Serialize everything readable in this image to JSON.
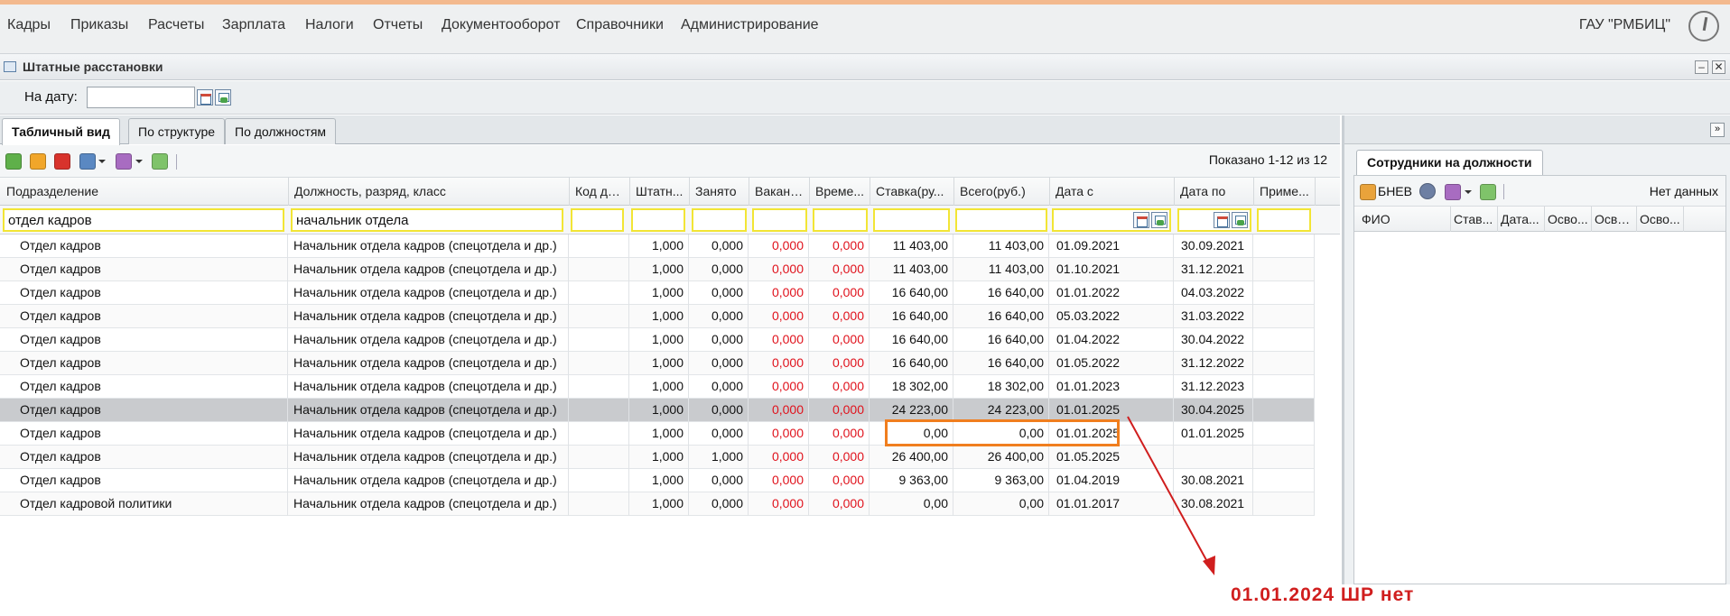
{
  "menu": {
    "items": [
      "Кадры",
      "Приказы",
      "Расчеты",
      "Зарплата",
      "Налоги",
      "Отчеты",
      "Документооборот",
      "Справочники",
      "Администрирование"
    ],
    "org": "ГАУ \"РМБИЦ\""
  },
  "window": {
    "title": "Штатные расстановки"
  },
  "date_filter": {
    "label": "На дату:",
    "value": ""
  },
  "tabs": [
    "Табличный вид",
    "По структуре",
    "По должностям"
  ],
  "toolbar": {
    "shown": "Показано 1-12 из 12"
  },
  "columns": [
    "Подразделение",
    "Должность, разряд, класс",
    "Код до...",
    "Штатн...",
    "Занято",
    "Вакант...",
    "Време...",
    "Ставка(ру...",
    "Всего(руб.)",
    "Дата с",
    "Дата по",
    "Приме..."
  ],
  "filters": {
    "department": "отдел кадров",
    "position": "начальник отдела"
  },
  "rows": [
    [
      "Отдел кадров",
      "Начальник отдела кадров (спецотдела и др.)",
      "",
      "1,000",
      "0,000",
      "0,000",
      "0,000",
      "11 403,00",
      "11 403,00",
      "01.09.2021",
      "30.09.2021",
      ""
    ],
    [
      "Отдел кадров",
      "Начальник отдела кадров (спецотдела и др.)",
      "",
      "1,000",
      "0,000",
      "0,000",
      "0,000",
      "11 403,00",
      "11 403,00",
      "01.10.2021",
      "31.12.2021",
      ""
    ],
    [
      "Отдел кадров",
      "Начальник отдела кадров (спецотдела и др.)",
      "",
      "1,000",
      "0,000",
      "0,000",
      "0,000",
      "16 640,00",
      "16 640,00",
      "01.01.2022",
      "04.03.2022",
      ""
    ],
    [
      "Отдел кадров",
      "Начальник отдела кадров (спецотдела и др.)",
      "",
      "1,000",
      "0,000",
      "0,000",
      "0,000",
      "16 640,00",
      "16 640,00",
      "05.03.2022",
      "31.03.2022",
      ""
    ],
    [
      "Отдел кадров",
      "Начальник отдела кадров (спецотдела и др.)",
      "",
      "1,000",
      "0,000",
      "0,000",
      "0,000",
      "16 640,00",
      "16 640,00",
      "01.04.2022",
      "30.04.2022",
      ""
    ],
    [
      "Отдел кадров",
      "Начальник отдела кадров (спецотдела и др.)",
      "",
      "1,000",
      "0,000",
      "0,000",
      "0,000",
      "16 640,00",
      "16 640,00",
      "01.05.2022",
      "31.12.2022",
      ""
    ],
    [
      "Отдел кадров",
      "Начальник отдела кадров (спецотдела и др.)",
      "",
      "1,000",
      "0,000",
      "0,000",
      "0,000",
      "18 302,00",
      "18 302,00",
      "01.01.2023",
      "31.12.2023",
      ""
    ],
    [
      "Отдел кадров",
      "Начальник отдела кадров (спецотдела и др.)",
      "",
      "1,000",
      "0,000",
      "0,000",
      "0,000",
      "24 223,00",
      "24 223,00",
      "01.01.2025",
      "30.04.2025",
      ""
    ],
    [
      "Отдел кадров",
      "Начальник отдела кадров (спецотдела и др.)",
      "",
      "1,000",
      "0,000",
      "0,000",
      "0,000",
      "0,00",
      "0,00",
      "01.01.2025",
      "01.01.2025",
      ""
    ],
    [
      "Отдел кадров",
      "Начальник отдела кадров (спецотдела и др.)",
      "",
      "1,000",
      "1,000",
      "0,000",
      "0,000",
      "26 400,00",
      "26 400,00",
      "01.05.2025",
      "",
      ""
    ],
    [
      "Отдел кадров",
      "Начальник отдела кадров (спецотдела и др.)",
      "",
      "1,000",
      "0,000",
      "0,000",
      "0,000",
      "9 363,00",
      "9 363,00",
      "01.04.2019",
      "30.08.2021",
      ""
    ],
    [
      "Отдел кадровой политики",
      "Начальник отдела кадров (спецотдела и др.)",
      "",
      "1,000",
      "0,000",
      "0,000",
      "0,000",
      "0,00",
      "0,00",
      "01.01.2017",
      "30.08.2021",
      ""
    ]
  ],
  "selected_row": 7,
  "right_panel": {
    "tab": "Сотрудники на должности",
    "bnev": "БНЕВ",
    "no_data": "Нет данных",
    "columns": [
      "ФИО",
      "Став...",
      "Дата...",
      "Осво...",
      "Осво...",
      "Осво..."
    ]
  },
  "annotation": {
    "text": "01.01.2024  ШР нет",
    "color": "#d01e1e"
  },
  "colors": {
    "accent": "#f3b98e",
    "vacancy": "#e0121c",
    "filter_highlight": "#f2e535",
    "annotation_box": "#f07e1e"
  }
}
